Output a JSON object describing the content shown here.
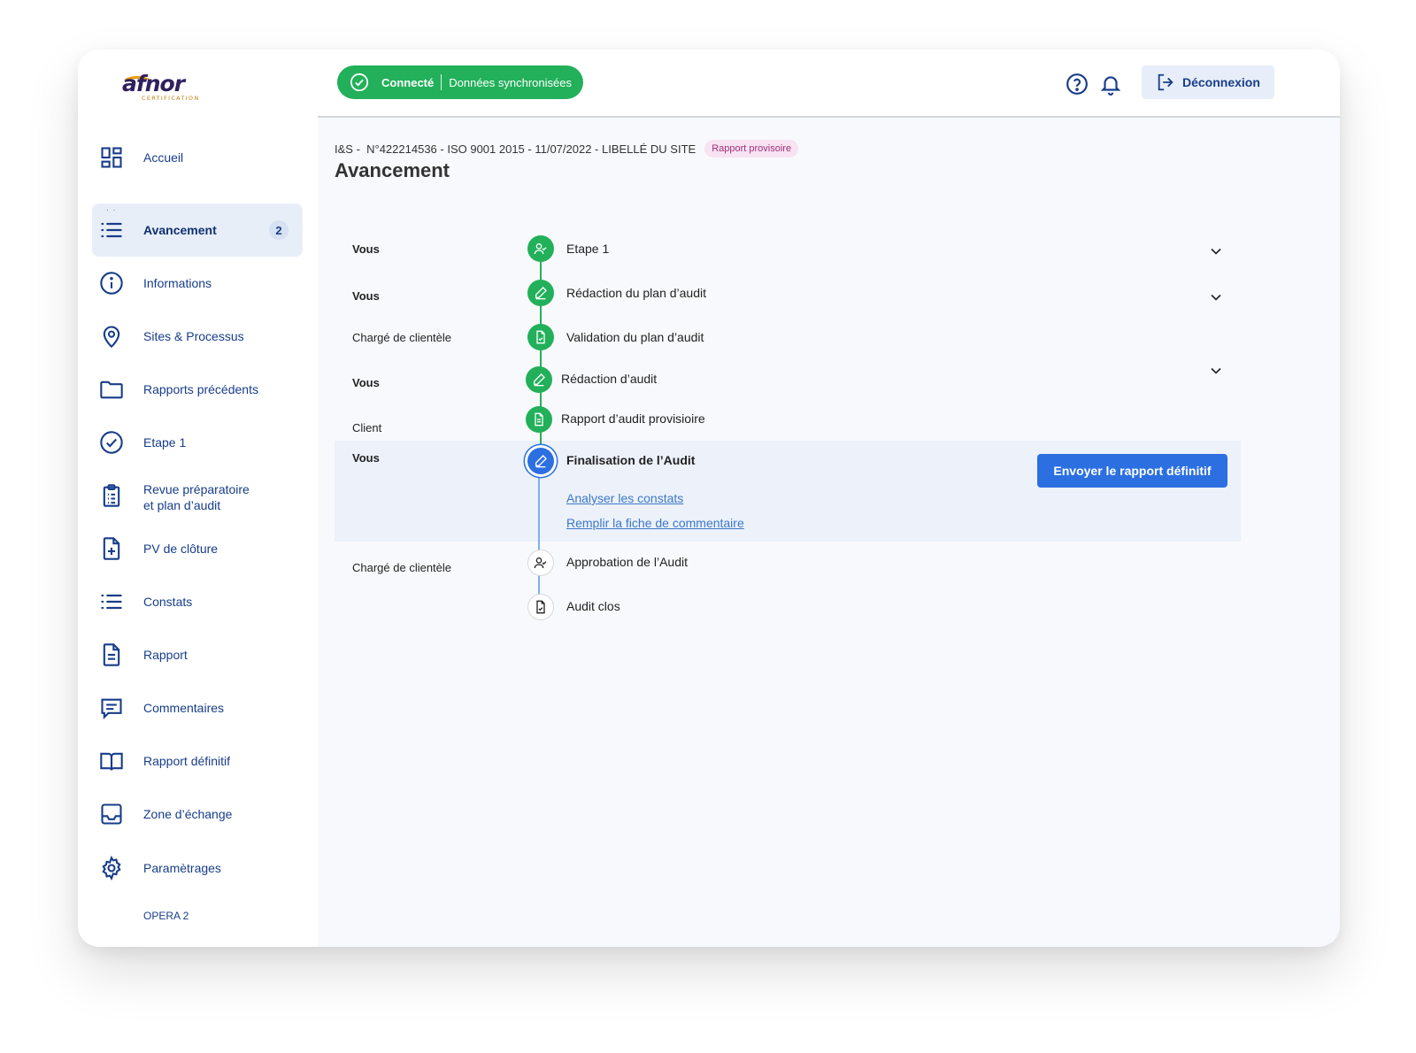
{
  "brand": {
    "name": "afnor",
    "sub": "CERTIFICATION"
  },
  "sidebar": {
    "items": [
      {
        "label": "Accueil",
        "icon": "dashboard-icon"
      },
      {
        "label": "Avancement",
        "icon": "list-icon",
        "badge": "2",
        "active": true
      },
      {
        "label": "Informations",
        "icon": "info-icon"
      },
      {
        "label": "Sites & Processus",
        "icon": "map-pin-icon"
      },
      {
        "label": "Rapports précédents",
        "icon": "folder-icon"
      },
      {
        "label": "Etape 1",
        "icon": "check-circle-icon"
      },
      {
        "label_line1": "Revue préparatoire",
        "label_line2": "et plan d’audit",
        "icon": "clipboard-icon"
      },
      {
        "label": "PV de clôture",
        "icon": "file-plus-icon"
      },
      {
        "label": "Constats",
        "icon": "list-icon"
      },
      {
        "label": "Rapport",
        "icon": "file-text-icon"
      },
      {
        "label": "Commentaires",
        "icon": "comment-icon"
      },
      {
        "label": "Rapport définitif",
        "icon": "book-icon"
      },
      {
        "label": "Zone d’échange",
        "icon": "inbox-icon"
      },
      {
        "label": "Paramètrages",
        "icon": "gear-icon"
      }
    ],
    "version": "OPERA 2"
  },
  "topbar": {
    "status_connected": "Connecté",
    "status_sync": "Données synchronisées",
    "logout_label": "Déconnexion"
  },
  "header": {
    "breadcrumb": "I&S -  N°422214536 - ISO 9001 2015 - 11/07/2022 - LIBELLÉ DU SITE",
    "tag": "Rapport provisoire",
    "title": "Avancement"
  },
  "timeline": {
    "steps": [
      {
        "actor": "Vous",
        "label": "Etape 1",
        "status": "done",
        "icon": "user-check-icon"
      },
      {
        "actor": "Vous",
        "label": "Rédaction du plan d’audit",
        "status": "done",
        "icon": "edit-icon"
      },
      {
        "actor": "Chargé de clientèle",
        "label": "Validation du plan d’audit",
        "status": "done",
        "icon": "file-check-icon"
      },
      {
        "actor": "Vous",
        "label": "Rédaction d’audit",
        "status": "done",
        "icon": "edit-icon"
      },
      {
        "actor": "Client",
        "label": "Rapport d’audit provisioire",
        "status": "done",
        "icon": "file-text-icon"
      },
      {
        "actor": "Vous",
        "label": "Finalisation de l’Audit",
        "status": "current",
        "icon": "edit-icon",
        "links": [
          "Analyser les constats",
          "Remplir la fiche de commentaire"
        ],
        "action": "Envoyer le rapport définitif"
      },
      {
        "actor": "Chargé de clientèle",
        "label": "Approbation de l’Audit",
        "status": "pending",
        "icon": "user-check-icon"
      },
      {
        "actor": "",
        "label": "Audit clos",
        "status": "pending",
        "icon": "file-check-icon"
      }
    ]
  },
  "colors": {
    "accent": "#2c6fe0",
    "success": "#22b05a",
    "nav": "#173d8a",
    "tag_bg": "#f7e3f2",
    "tag_text": "#a0307a"
  }
}
